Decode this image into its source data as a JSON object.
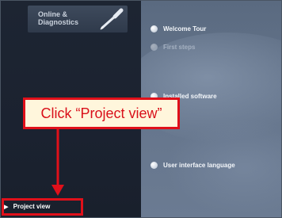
{
  "sidebar": {
    "tile": {
      "label": "Online & Diagnostics",
      "icon": "probe-icon"
    },
    "project_view_link": "Project view"
  },
  "portal_menu": {
    "items": [
      {
        "label": "Welcome Tour",
        "state": "normal"
      },
      {
        "label": "First steps",
        "state": "dim"
      },
      {
        "label": "Installed software",
        "state": "normal"
      },
      {
        "label": "User interface language",
        "state": "normal"
      }
    ]
  },
  "annotation": {
    "callout_text": "Click “Project view”",
    "accent_color": "#e0101a"
  }
}
